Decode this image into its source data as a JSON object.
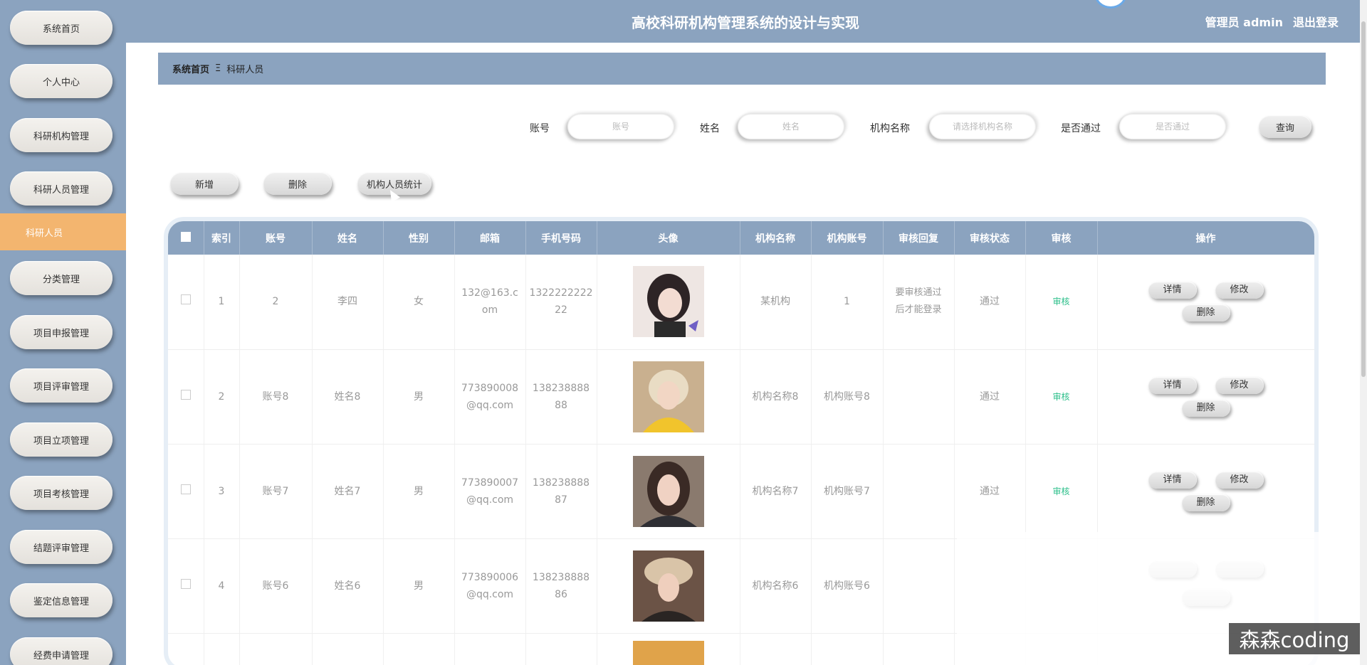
{
  "header": {
    "title": "高校科研机构管理系统的设计与实现",
    "user": "管理员 admin",
    "logout": "退出登录"
  },
  "sidebar": {
    "items": [
      "系统首页",
      "个人中心",
      "科研机构管理",
      "科研人员管理",
      "分类管理",
      "项目申报管理",
      "项目评审管理",
      "项目立项管理",
      "项目考核管理",
      "结题评审管理",
      "鉴定信息管理",
      "经费申请管理"
    ],
    "active_sub": "科研人员"
  },
  "breadcrumb": {
    "home": "系统首页",
    "separator": "Ξ",
    "current": "科研人员"
  },
  "search": {
    "account_label": "账号",
    "account_placeholder": "账号",
    "name_label": "姓名",
    "name_placeholder": "姓名",
    "org_label": "机构名称",
    "org_placeholder": "请选择机构名称",
    "pass_label": "是否通过",
    "pass_placeholder": "是否通过",
    "query_button": "查询"
  },
  "actions": {
    "add": "新增",
    "delete": "删除",
    "stats": "机构人员统计"
  },
  "table": {
    "headers": [
      "索引",
      "账号",
      "姓名",
      "性别",
      "邮箱",
      "手机号码",
      "头像",
      "机构名称",
      "机构账号",
      "审核回复",
      "审核状态",
      "审核",
      "操作"
    ],
    "rows": [
      {
        "index": "1",
        "account": "2",
        "name": "李四",
        "gender": "女",
        "email": "132@163.c om",
        "phone": "1322222222 22",
        "org": "某机构",
        "org_account": "1",
        "reply": "要审核通过后才能登录",
        "status": "通过",
        "audit": "审核"
      },
      {
        "index": "2",
        "account": "账号8",
        "name": "姓名8",
        "gender": "男",
        "email": "773890008 @qq.com",
        "phone": "138238888 88",
        "org": "机构名称8",
        "org_account": "机构账号8",
        "reply": "",
        "status": "通过",
        "audit": "审核"
      },
      {
        "index": "3",
        "account": "账号7",
        "name": "姓名7",
        "gender": "男",
        "email": "773890007 @qq.com",
        "phone": "138238888 87",
        "org": "机构名称7",
        "org_account": "机构账号7",
        "reply": "",
        "status": "通过",
        "audit": "审核"
      },
      {
        "index": "4",
        "account": "账号6",
        "name": "姓名6",
        "gender": "男",
        "email": "773890006 @qq.com",
        "phone": "138238888 86",
        "org": "机构名称6",
        "org_account": "机构账号6",
        "reply": "",
        "status": "",
        "audit": ""
      }
    ],
    "op_labels": {
      "detail": "详情",
      "edit": "修改",
      "delete": "删除"
    }
  },
  "watermark": "森森coding",
  "colors": {
    "primary": "#8ba3bf",
    "active": "#f3b56f",
    "audit": "#2bbf8a"
  }
}
